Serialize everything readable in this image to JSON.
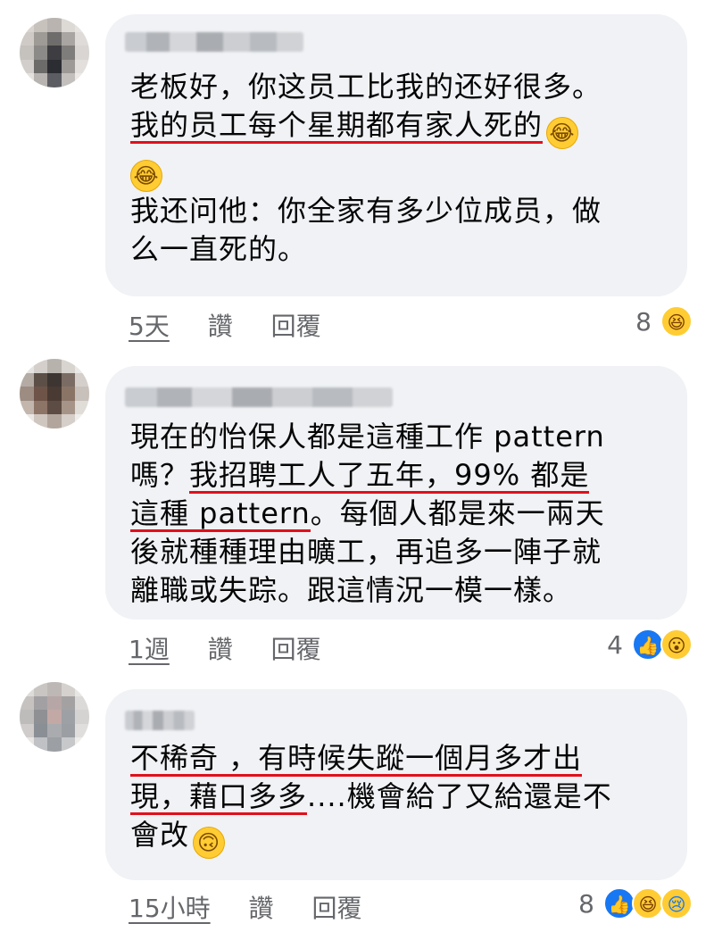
{
  "comments": [
    {
      "lines": [
        {
          "plain": "老板好，你这员工比我的还好很多。",
          "underlined": ""
        },
        {
          "plain": "",
          "underlined": "我的员工每个星期都有家人死的",
          "emoji": "😂"
        },
        {
          "plain": "",
          "underlined": "",
          "emoji": "😂"
        },
        {
          "plain": "我还问他：你全家有多少位成员，做",
          "underlined": ""
        },
        {
          "plain": "么一直死的。",
          "underlined": ""
        }
      ],
      "time": "5天",
      "like": "讚",
      "reply": "回覆",
      "reaction_count": "8",
      "reaction_icons": [
        "haha-icon"
      ]
    },
    {
      "lines": [
        {
          "plain": "現在的怡保人都是這種工作 pattern",
          "underlined": ""
        },
        {
          "plain": "嗎？",
          "underlined": "我招聘工人了五年，99% 都是"
        },
        {
          "plain": "",
          "underlined": "這種 pattern",
          "tail": "。每個人都是來一兩天"
        },
        {
          "plain": "後就種種理由曠工，再追多一陣子就",
          "underlined": ""
        },
        {
          "plain": "離職或失踪。跟這情況一模一樣。",
          "underlined": ""
        }
      ],
      "time": "1週",
      "like": "讚",
      "reply": "回覆",
      "reaction_count": "4",
      "reaction_icons": [
        "like-icon",
        "wow-icon"
      ]
    },
    {
      "lines": [
        {
          "plain": "",
          "underlined": "不稀奇 ，有時候失蹤一個月多才出"
        },
        {
          "plain": "",
          "underlined": "現，藉口多多",
          "tail": "....機會給了又給還是不"
        },
        {
          "plain": "會改",
          "underlined": "",
          "emoji": "🙃"
        }
      ],
      "time": "15小時",
      "like": "讚",
      "reply": "回覆",
      "reaction_count": "8",
      "reaction_icons": [
        "like-icon",
        "haha-icon",
        "sad-icon"
      ]
    }
  ]
}
